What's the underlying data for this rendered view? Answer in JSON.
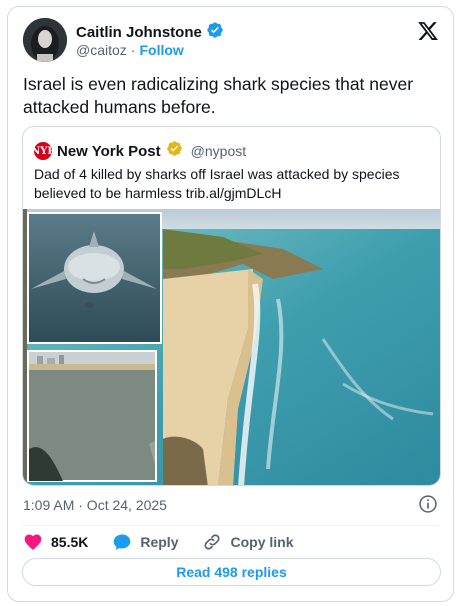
{
  "author": {
    "name": "Caitlin Johnstone",
    "handle": "@caitoz",
    "follow_label": "Follow",
    "separator": "·"
  },
  "tweet": {
    "text": "Israel is even radicalizing shark species that never attacked humans before."
  },
  "quote": {
    "logo_text": "NYP",
    "name": "New York Post",
    "handle": "@nypost",
    "text": "Dad of 4 killed by sharks off Israel was attacked by species believed to be harmless trib.al/gjmDLcH"
  },
  "meta": {
    "timestamp": "1:09 AM · Oct 24, 2025"
  },
  "actions": {
    "likes": "85.5K",
    "reply_label": "Reply",
    "copy_label": "Copy link"
  },
  "read_replies_label": "Read 498 replies",
  "colors": {
    "accent": "#1d9bf0",
    "like": "#f91880",
    "verified_blue": "#1d9bf0",
    "verified_gold": "#e2b719"
  }
}
